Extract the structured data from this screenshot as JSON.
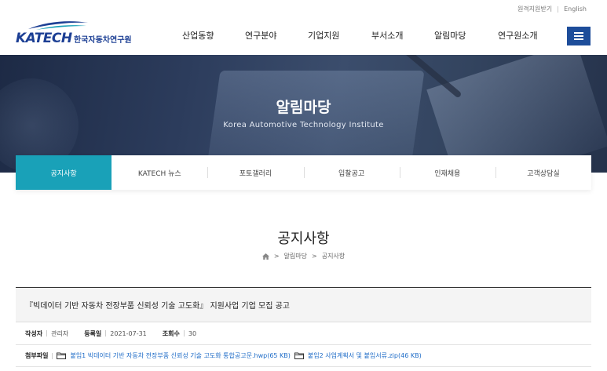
{
  "util": {
    "remote_support": "원격지원받기",
    "english": "English"
  },
  "logo": {
    "brand": "KATECH",
    "brand_kr": "한국자동차연구원"
  },
  "gnb": [
    "산업동향",
    "연구분야",
    "기업지원",
    "부서소개",
    "알림마당",
    "연구원소개"
  ],
  "hero": {
    "title": "알림마당",
    "subtitle": "Korea Automotive Technology Institute"
  },
  "tabs": [
    "공지사항",
    "KATECH 뉴스",
    "포토갤러리",
    "입찰공고",
    "인재채용",
    "고객상담실"
  ],
  "page": {
    "title": "공지사항",
    "breadcrumb": [
      "알림마당",
      "공지사항"
    ]
  },
  "post": {
    "title": "『빅데이터 기반 자동차 전장부품 신뢰성 기술 고도화』 지원사업 기업 모집 공고",
    "author_label": "작성자",
    "author": "관리자",
    "date_label": "등록일",
    "date": "2021-07-31",
    "views_label": "조회수",
    "views": "30",
    "attach_label": "첨부파일",
    "attachments": [
      "붙임1 빅데이터 기반 자동차 전장부품 신뢰성 기술 고도화 통합공고문.hwp(65 KB)",
      "붙임2 사업계획서 및 붙임서류.zip(46 KB)"
    ]
  },
  "colors": {
    "brand": "#1c3f94",
    "accent": "#19a1b8",
    "menu": "#1d4d9a",
    "link": "#1d6bc7"
  }
}
